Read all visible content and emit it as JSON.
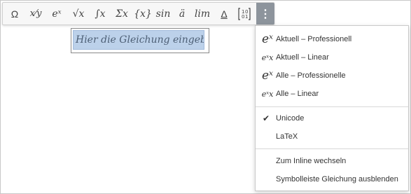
{
  "toolbar": {
    "buttons": [
      {
        "label": "Ω"
      },
      {
        "label": "x⁄y"
      },
      {
        "label": "eˣ"
      },
      {
        "label": "√x"
      },
      {
        "label": "∫x"
      },
      {
        "label": "Σx"
      },
      {
        "label": "{x}"
      },
      {
        "label": "sin"
      },
      {
        "label": "ä"
      },
      {
        "label": "lim"
      },
      {
        "label": "Δ"
      },
      {
        "label": "[10;01]"
      }
    ],
    "more_label": "⋮"
  },
  "equation": {
    "placeholder": "Hier die Gleichung eingeben."
  },
  "menu": {
    "items": [
      {
        "icon": "eˣ",
        "label": "Aktuell – Professionell"
      },
      {
        "icon": "eˣx",
        "label": "Aktuell – Linear"
      },
      {
        "icon": "eˣ",
        "label": "Alle – Professionelle"
      },
      {
        "icon": "eˣx",
        "label": "Alle – Linear"
      },
      {
        "check": "✔",
        "label": "Unicode"
      },
      {
        "label": "LaTeX"
      },
      {
        "label": "Zum Inline wechseln"
      },
      {
        "label": "Symbolleiste Gleichung ausblenden"
      }
    ]
  }
}
